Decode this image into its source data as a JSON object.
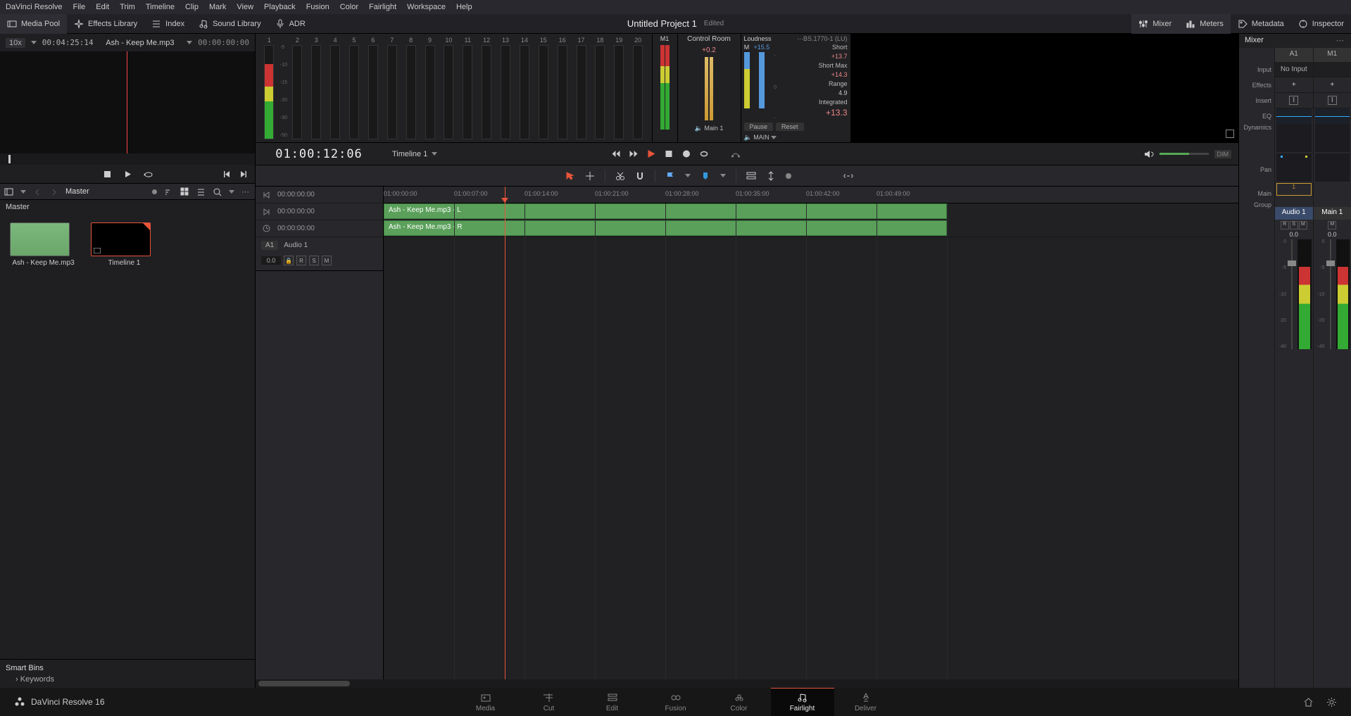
{
  "app": {
    "name": "DaVinci Resolve",
    "version_label": "DaVinci Resolve 16"
  },
  "menubar": [
    "DaVinci Resolve",
    "File",
    "Edit",
    "Trim",
    "Timeline",
    "Clip",
    "Mark",
    "View",
    "Playback",
    "Fusion",
    "Color",
    "Fairlight",
    "Workspace",
    "Help"
  ],
  "toolbar": {
    "media_pool": "Media Pool",
    "effects_library": "Effects Library",
    "index": "Index",
    "sound_library": "Sound Library",
    "adr": "ADR",
    "mixer": "Mixer",
    "meters": "Meters",
    "metadata": "Metadata",
    "inspector": "Inspector"
  },
  "project": {
    "title": "Untitled Project 1",
    "status": "Edited"
  },
  "source_viewer": {
    "zoom": "10x",
    "timecode": "00:04:25:14",
    "filename": "Ash - Keep Me.mp3",
    "duration": "00:00:00:00"
  },
  "media_pool": {
    "bin_label": "Master",
    "items": [
      {
        "name": "Ash - Keep Me.mp3",
        "type": "audio"
      },
      {
        "name": "Timeline 1",
        "type": "timeline"
      }
    ],
    "smart_bins": "Smart Bins",
    "keywords": "Keywords"
  },
  "track_meters": {
    "count": 20,
    "m1_label": "M1",
    "scale": [
      "-5",
      "-10",
      "-15",
      "-20",
      "-30",
      "-50"
    ]
  },
  "control_room": {
    "title": "Control Room",
    "value": "+0.2",
    "main_sel": "Main 1"
  },
  "loudness": {
    "title": "Loudness",
    "standard": "BS.1770-1 (LU)",
    "m_label": "M",
    "m_value": "+15.5",
    "short": {
      "label": "Short",
      "value": "+13.7"
    },
    "short_max": {
      "label": "Short Max",
      "value": "+14.3"
    },
    "range": {
      "label": "Range",
      "value": "4.9"
    },
    "integrated": {
      "label": "Integrated",
      "value": "+13.3"
    },
    "pause": "Pause",
    "reset": "Reset",
    "main_sel": "MAIN"
  },
  "timeline": {
    "current_tc": "01:00:12:06",
    "name": "Timeline 1",
    "tc_list": [
      "00:00:00:00",
      "00:00:00:00",
      "00:00:00:00"
    ],
    "ruler": [
      "01:00:00:00",
      "01:00:07:00",
      "01:00:14:00",
      "01:00:21:00",
      "01:00:28:00",
      "01:00:35:00",
      "01:00:42:00",
      "01:00:49:00"
    ],
    "track": {
      "id": "A1",
      "name": "Audio 1",
      "db": "0.0",
      "flags": {
        "r": "R",
        "s": "S",
        "m": "M"
      }
    },
    "clips": {
      "left": "Ash - Keep Me.mp3 - L",
      "right": "Ash - Keep Me.mp3 - R"
    },
    "dim": "DIM"
  },
  "mixer": {
    "title": "Mixer",
    "labels": {
      "input": "Input",
      "effects": "Effects",
      "insert": "Insert",
      "eq": "EQ",
      "dynamics": "Dynamics",
      "pan": "Pan",
      "main": "Main",
      "group": "Group"
    },
    "plus": "+",
    "i_label": "I",
    "main_val": "1",
    "no_input": "No Input",
    "channels": [
      {
        "id": "A1",
        "name": "Audio 1",
        "db": "0.0",
        "rsm": [
          "R",
          "S",
          "M"
        ]
      },
      {
        "id": "M1",
        "name": "Main 1",
        "db": "0.0",
        "rsm": [
          "M"
        ]
      }
    ],
    "fader_scale": [
      "0",
      "-5",
      "-10",
      "-20",
      "-40"
    ]
  },
  "pages": [
    "Media",
    "Cut",
    "Edit",
    "Fusion",
    "Color",
    "Fairlight",
    "Deliver"
  ],
  "active_page": "Fairlight"
}
